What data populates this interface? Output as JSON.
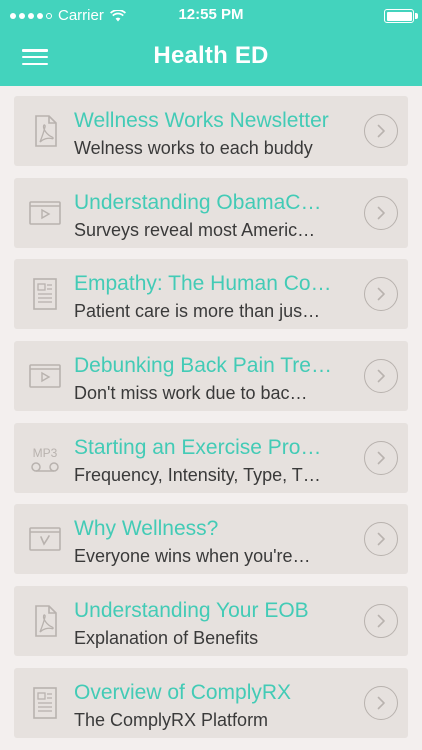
{
  "status_bar": {
    "carrier": "Carrier",
    "time": "12:55 PM"
  },
  "nav": {
    "title": "Health ED"
  },
  "colors": {
    "header": "#43d3bd",
    "accent_text": "#43cbb6",
    "card": "#e6e1de",
    "background": "#f3efee"
  },
  "items": [
    {
      "icon": "pdf-icon",
      "title": "Wellness Works Newsletter",
      "subtitle": "Welness works to each buddy"
    },
    {
      "icon": "video-icon",
      "title": "Understanding ObamaC…",
      "subtitle": "Surveys reveal most Americ…"
    },
    {
      "icon": "article-icon",
      "title": "Empathy: The Human Co…",
      "subtitle": "Patient care is more than jus…"
    },
    {
      "icon": "video-icon",
      "title": "Debunking Back Pain Tre…",
      "subtitle": "Don't miss work due to bac…"
    },
    {
      "icon": "mp3-icon",
      "title": "Starting an Exercise Pro…",
      "subtitle": "Frequency, Intensity, Type, T…",
      "icon_label": "MP3"
    },
    {
      "icon": "vimeo-icon",
      "title": "Why Wellness?",
      "subtitle": "Everyone wins when you're…"
    },
    {
      "icon": "pdf-icon",
      "title": "Understanding Your EOB",
      "subtitle": "Explanation of Benefits"
    },
    {
      "icon": "article-icon",
      "title": "Overview of ComplyRX",
      "subtitle": "The ComplyRX Platform"
    }
  ]
}
